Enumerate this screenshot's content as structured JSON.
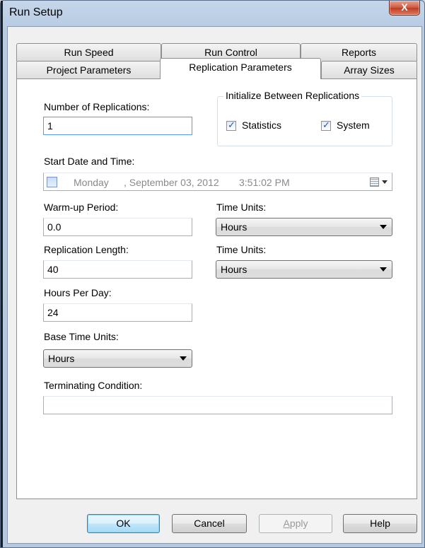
{
  "window": {
    "title": "Run Setup",
    "close_glyph": "X"
  },
  "tabs": {
    "back_row": [
      "Run Speed",
      "Run Control",
      "Reports"
    ],
    "front_row": [
      "Project Parameters",
      "Replication Parameters",
      "Array Sizes"
    ],
    "active": "Replication Parameters"
  },
  "form": {
    "num_replications_label": "Number of Replications:",
    "num_replications_value": "1",
    "init_group_title": "Initialize Between Replications",
    "statistics_label": "Statistics",
    "statistics_checked": true,
    "system_label": "System",
    "system_checked": true,
    "start_label": "Start Date and Time:",
    "start_day": "Monday",
    "start_date": ", September 03, 2012",
    "start_time": "3:51:02 PM",
    "warmup_label": "Warm-up Period:",
    "warmup_value": "0.0",
    "warmup_units_label": "Time Units:",
    "warmup_units_value": "Hours",
    "replen_label": "Replication Length:",
    "replen_value": "40",
    "replen_units_label": "Time Units:",
    "replen_units_value": "Hours",
    "hours_label": "Hours Per Day:",
    "hours_value": "24",
    "base_units_label": "Base Time Units:",
    "base_units_value": "Hours",
    "terminating_label": "Terminating Condition:",
    "terminating_value": ""
  },
  "buttons": {
    "ok": "OK",
    "cancel": "Cancel",
    "apply_underlined": "A",
    "apply_rest": "pply",
    "help": "Help"
  },
  "icons": {
    "check": "check-mark-icon",
    "calendar": "calendar-icon"
  }
}
